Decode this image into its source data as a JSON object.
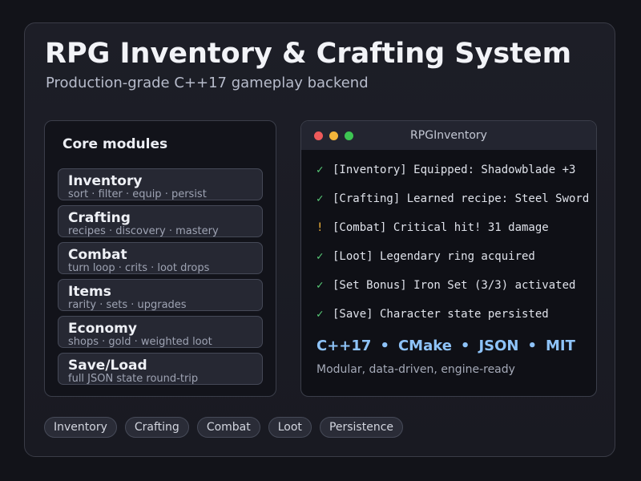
{
  "header": {
    "title": "RPG Inventory & Crafting System",
    "subtitle": "Production-grade C++17 gameplay backend"
  },
  "modules": {
    "heading": "Core modules",
    "items": [
      {
        "name": "Inventory",
        "desc": "sort · filter · equip · persist"
      },
      {
        "name": "Crafting",
        "desc": "recipes · discovery · mastery"
      },
      {
        "name": "Combat",
        "desc": "turn loop · crits · loot drops"
      },
      {
        "name": "Items",
        "desc": "rarity · sets · upgrades"
      },
      {
        "name": "Economy",
        "desc": "shops · gold · weighted loot"
      },
      {
        "name": "Save/Load",
        "desc": "full JSON state round-trip"
      }
    ]
  },
  "terminal": {
    "title": "RPGInventory",
    "lines": [
      {
        "mark": "✓",
        "status": "success",
        "text": "[Inventory] Equipped: Shadowblade +3"
      },
      {
        "mark": "✓",
        "status": "success",
        "text": "[Crafting] Learned recipe: Steel Sword"
      },
      {
        "mark": "!",
        "status": "warning",
        "text": "[Combat] Critical hit! 31 damage"
      },
      {
        "mark": "✓",
        "status": "success",
        "text": "[Loot] Legendary ring acquired"
      },
      {
        "mark": "✓",
        "status": "success",
        "text": "[Set Bonus] Iron Set (3/3) activated"
      },
      {
        "mark": "✓",
        "status": "success",
        "text": "[Save] Character state persisted"
      }
    ],
    "tech": [
      "C++17",
      "CMake",
      "JSON",
      "MIT"
    ],
    "tech_separator": "•",
    "tagline": "Modular, data-driven, engine-ready"
  },
  "tags": [
    "Inventory",
    "Crafting",
    "Combat",
    "Loot",
    "Persistence"
  ],
  "colors": {
    "background": "#121319",
    "card": "#1d1e27",
    "accent_blue": "#8ec3f8",
    "success_green": "#5ad07a",
    "warning_amber": "#f3b53a",
    "window_red": "#ee5a5a",
    "window_yellow": "#f3b53a",
    "window_green": "#3dc552"
  },
  "icons": {
    "window_controls": [
      "close-dot",
      "minimize-dot",
      "maximize-dot"
    ],
    "success": "check-icon",
    "warning": "exclamation-icon"
  }
}
